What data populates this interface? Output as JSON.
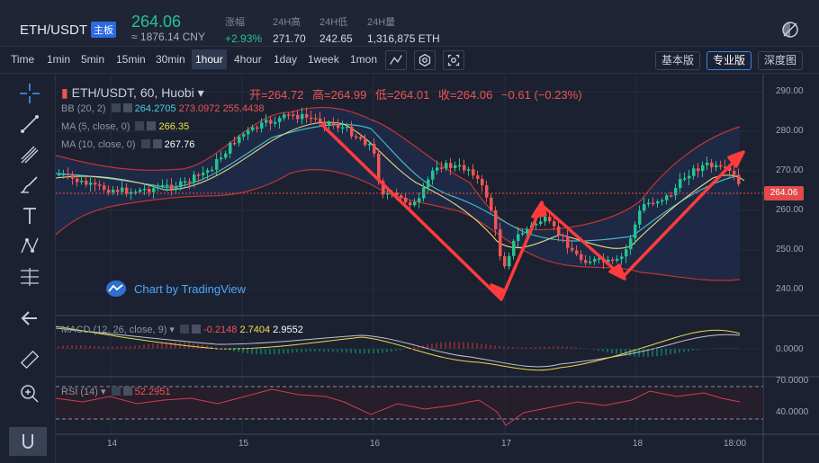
{
  "ticker": {
    "pair": "ETH/USDT",
    "badge": "主板",
    "last_price": "264.06",
    "cny_price": "≈ 1876.14 CNY",
    "stats": [
      {
        "label": "涨幅",
        "value": "+2.93%"
      },
      {
        "label": "24H高",
        "value": "271.70"
      },
      {
        "label": "24H低",
        "value": "242.65"
      },
      {
        "label": "24H量",
        "value": "1,316,875 ETH"
      }
    ]
  },
  "toolbar": {
    "timeframes": [
      "Time",
      "1min",
      "5min",
      "15min",
      "30min",
      "1hour",
      "4hour",
      "1day",
      "1week",
      "1mon"
    ],
    "active_timeframe": "1hour",
    "tool_icons": [
      "indicator-icon",
      "settings-icon",
      "screenshot-icon"
    ],
    "views": [
      "基本版",
      "专业版",
      "深度图"
    ],
    "active_view": "专业版"
  },
  "left_tools": [
    "crosshair-icon",
    "trendline-icon",
    "pitchfork-icon",
    "brush-icon",
    "text-icon",
    "pattern-icon",
    "measure-icon",
    "back-arrow-icon",
    "ruler-icon",
    "zoom-in-icon",
    "magnet-icon"
  ],
  "chart": {
    "title": "ETH/USDT, 60, Huobi",
    "ohlc": {
      "open": "开=264.72",
      "high": "高=264.99",
      "low": "低=264.01",
      "close": "收=264.06",
      "change": "−0.61 (−0.23%)"
    },
    "indicators": {
      "bb": {
        "label": "BB (20, 2)",
        "v1": "264.2705",
        "v2": "273.0972",
        "v3": "255.4438"
      },
      "ma5": {
        "label": "MA (5, close, 0)",
        "v": "266.35"
      },
      "ma10": {
        "label": "MA (10, close, 0)",
        "v": "267.76"
      },
      "macd": {
        "label": "MACD (12, 26, close, 9)",
        "v1": "-0.2148",
        "v2": "2.7404",
        "v3": "2.9552"
      },
      "rsi": {
        "label": "RSI (14)",
        "v": "52.2951"
      }
    },
    "watermark": "Chart by TradingView",
    "price_axis": [
      "290.00",
      "280.00",
      "270.00",
      "260.00",
      "250.00",
      "240.00"
    ],
    "current_price_tag": "264.06",
    "macd_axis": [
      "0.0000"
    ],
    "rsi_axis": [
      "70.0000",
      "40.0000"
    ],
    "time_axis": [
      "14",
      "15",
      "16",
      "17",
      "18",
      "18:00"
    ],
    "colors": {
      "up": "#25c391",
      "down": "#f05454",
      "bb": "#d03a3a",
      "ma5": "#e7d77a",
      "ma10": "#43b8c8",
      "arrow": "#ff3b3b"
    }
  }
}
